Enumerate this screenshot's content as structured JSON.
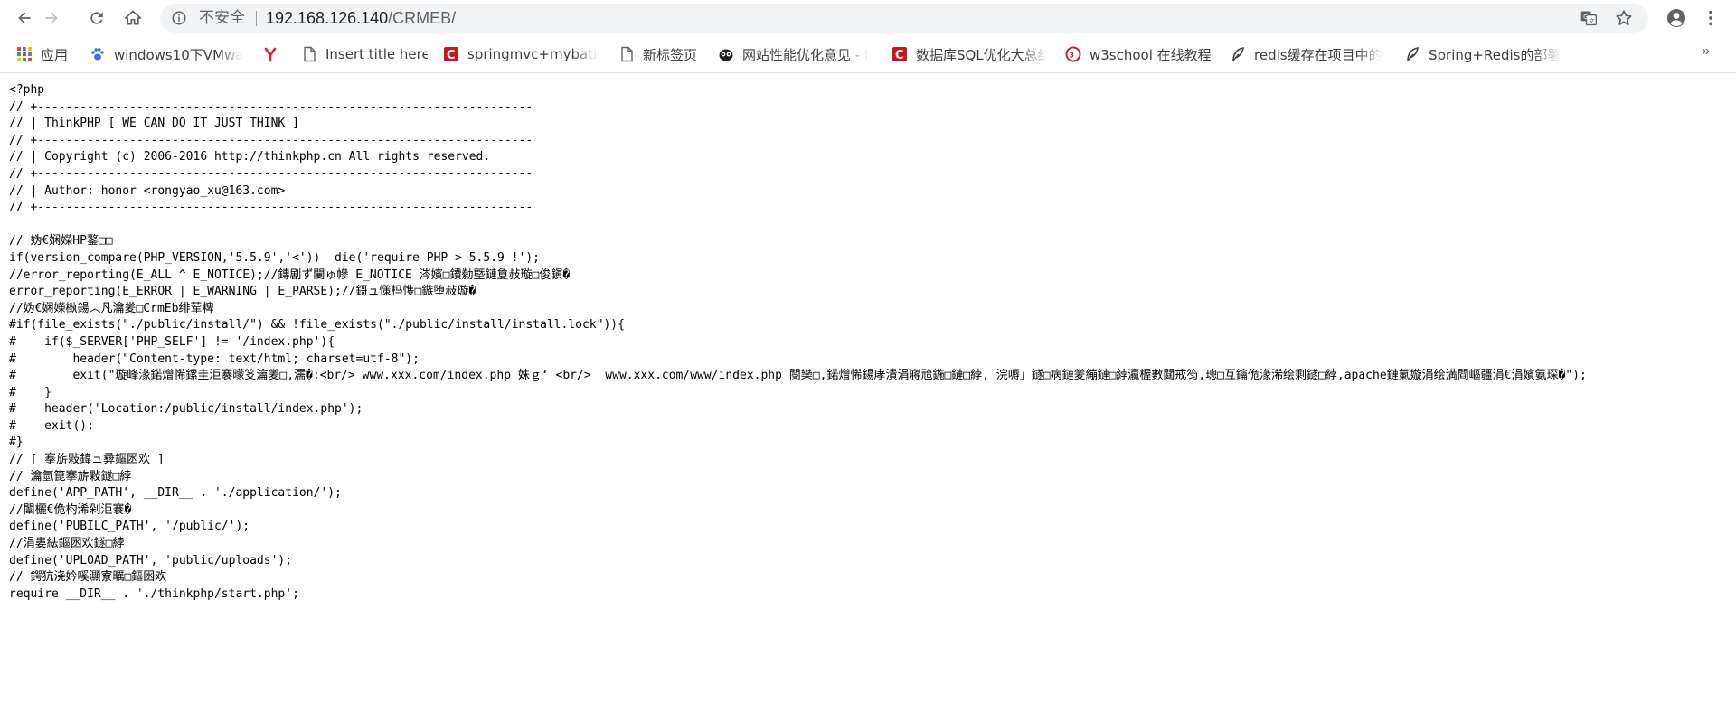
{
  "browser": {
    "insecure_label": "不安全",
    "url_host": "192.168.126.140",
    "url_path": "/CRMEB/"
  },
  "bookmarks": [
    {
      "label": "应用",
      "icon": "apps-grid-icon"
    },
    {
      "label": "windows10下VMwa",
      "icon": "paw-icon"
    },
    {
      "label": "",
      "icon": "y-logo-icon"
    },
    {
      "label": "Insert title here",
      "icon": "page-icon"
    },
    {
      "label": "springmvc+mybatis",
      "icon": "csdn-icon"
    },
    {
      "label": "新标签页",
      "icon": "page-icon"
    },
    {
      "label": "网站性能优化意见 - f",
      "icon": "owl-icon"
    },
    {
      "label": "数据库SQL优化大总结",
      "icon": "csdn-icon"
    },
    {
      "label": "w3school 在线教程",
      "icon": "w3school-icon"
    },
    {
      "label": "redis缓存在项目中的",
      "icon": "feather-icon"
    },
    {
      "label": "Spring+Redis的部署",
      "icon": "feather-icon"
    }
  ],
  "code_lines": [
    "<?php",
    "// +----------------------------------------------------------------------",
    "// | ThinkPHP [ WE CAN DO IT JUST THINK ]",
    "// +----------------------------------------------------------------------",
    "// | Copyright (c) 2006-2016 http://thinkphp.cn All rights reserved.",
    "// +----------------------------------------------------------------------",
    "// | Author: honor <rongyao_xu@163.com>",
    "// +----------------------------------------------------------------------",
    "",
    "// 妫€娴嬫HP鐜□□",
    "if(version_compare(PHP_VERSION,'5.5.9','<'))  die('require PHP > 5.5.9 !');",
    "//error_reporting(E_ALL ^ E_NOTICE);//鏄剧ず闄ゅ幓 E_NOTICE 涔嬪□鐨勬墍鏈夐敊璇□俊鎭�",
    "error_reporting(E_ERROR | E_WARNING | E_PARSE);//鎶ュ憡杩愯□鏃堕敊璇�",
    "//妫€娴嬫槸鍚︿凡瀹夎□CrmEb绯荤粺",
    "#if(file_exists(\"./public/install/\") && !file_exists(\"./public/install/install.lock\")){",
    "#    if($_SERVER['PHP_SELF'] != '/index.php'){",
    "#        header(\"Content-type: text/html; charset=utf-8\");",
    "#        exit(\"璇峰湪鍩熷悕鏍圭洰褰曚笅瀹夎□,濡�:<br/> www.xxx.com/index.php 姝ｇ‘ <br/>  www.xxx.com/www/index.php 閿欒□,鍩熷悕鍚庨潰涓嶈兘鍦□鏈□綍, 浣嗕」鐩□病鏈夎繃鏈□綍瀛楃數閮戒笉,璁□互鑰佹湪浠绘剩鐩□綍,apache鏈氭嫙涓绘満閰嶇疆涓€涓嬪氨琛�\");",
    "#    }",
    "#    header('Location:/public/install/index.php');",
    "#    exit();",
    "#}",
    "// [ 搴旂敤鍏ュ彛鏂囦欢 ]",
    "// 瀹氫箟搴旂敤鐩□綍",
    "define('APP_PATH', __DIR__ . './application/');",
    "//闈欐€佹枃浠剁洰褰�",
    "define('PUBILC_PATH', '/public/');",
    "//涓婁紶鏂囦欢鐩□綍",
    "define('UPLOAD_PATH', 'public/uploads');",
    "// 鍔犺浇妗嗘灦寮曞□鏂囦欢",
    "require __DIR__ . './thinkphp/start.php';"
  ]
}
